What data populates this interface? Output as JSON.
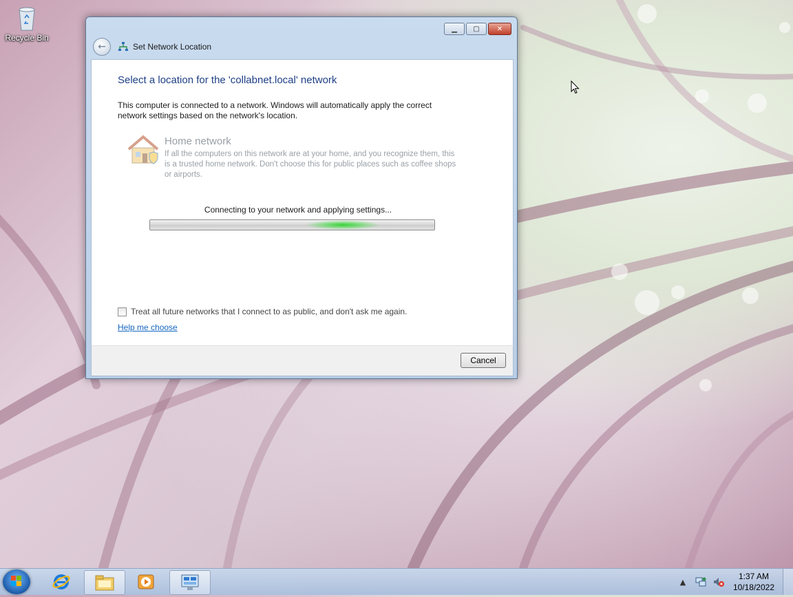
{
  "desktop": {
    "icons": [
      {
        "label": "Recycle Bin",
        "icon": "recycle-bin-icon"
      }
    ]
  },
  "window": {
    "title": "Set Network Location",
    "heading": "Select a location for the 'collabnet.local' network",
    "intro": "This computer is connected to a network. Windows will automatically apply the correct network settings based on the network's location.",
    "option": {
      "title": "Home network",
      "description": "If all the computers on this network are at your home, and you recognize them, this is a trusted home network.  Don't choose this for public places such as coffee shops or airports.",
      "icon": "home-icon"
    },
    "progress": {
      "label": "Connecting to your network and applying settings...",
      "state": "indeterminate"
    },
    "checkbox": {
      "label": "Treat all future networks that I connect to as public, and don't ask me again.",
      "checked": false
    },
    "help_link": "Help me choose",
    "cancel_label": "Cancel"
  },
  "taskbar": {
    "items": [
      {
        "icon": "internet-explorer-icon"
      },
      {
        "icon": "file-explorer-icon"
      },
      {
        "icon": "media-player-icon"
      },
      {
        "icon": "network-location-icon"
      }
    ],
    "clock": {
      "time": "1:37 AM",
      "date": "10/18/2022"
    }
  },
  "colors": {
    "heading": "#1e3f86",
    "link": "#1565c0",
    "progress_glow": "#38d33a"
  }
}
